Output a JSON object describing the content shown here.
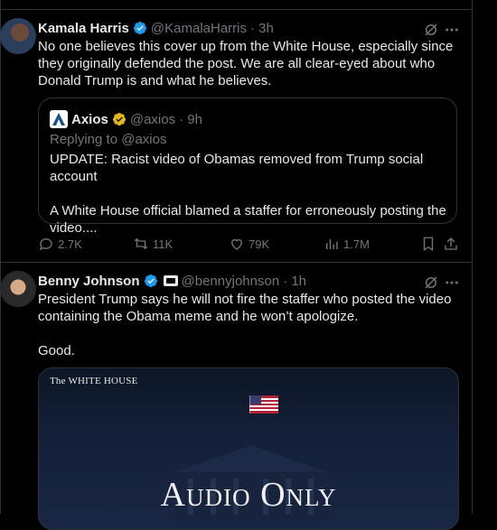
{
  "colors": {
    "background": "#000000",
    "text": "#e7e9ea",
    "muted": "#71767b",
    "border": "#2f3336",
    "verified_blue": "#1d9bf0",
    "verified_gold": "#e2b719"
  },
  "tweet1": {
    "name": "Kamala Harris",
    "handle": "@KamalaHarris",
    "time": "· 3h",
    "text": "No one believes this cover up from the White House, especially since they originally defended the post. We are all clear-eyed about who Donald Trump is and what he believes.",
    "quote": {
      "name": "Axios",
      "handle": "@axios",
      "time": "· 9h",
      "replying_to": "Replying to",
      "replying_handle": "@axios",
      "text": "UPDATE: Racist video of Obamas removed from Trump social account\n\nA White House official blamed a staffer for erroneously posting the video...."
    },
    "actions": {
      "replies": "2.7K",
      "reposts": "11K",
      "likes": "79K",
      "views": "1.7M"
    }
  },
  "tweet2": {
    "name": "Benny Johnson",
    "handle": "@bennyjohnson",
    "time": "· 1h",
    "text": "President Trump says he will not fire the staffer who posted the video containing the Obama meme and he won’t apologize.\n\nGood.",
    "media": {
      "label": "The WHITE HOUSE",
      "title": "Audio Only"
    }
  },
  "icons": [
    "verified-badge",
    "grok-icon",
    "more-icon",
    "reply-icon",
    "repost-icon",
    "like-icon",
    "views-icon",
    "bookmark-icon",
    "share-icon",
    "flag-icon"
  ]
}
